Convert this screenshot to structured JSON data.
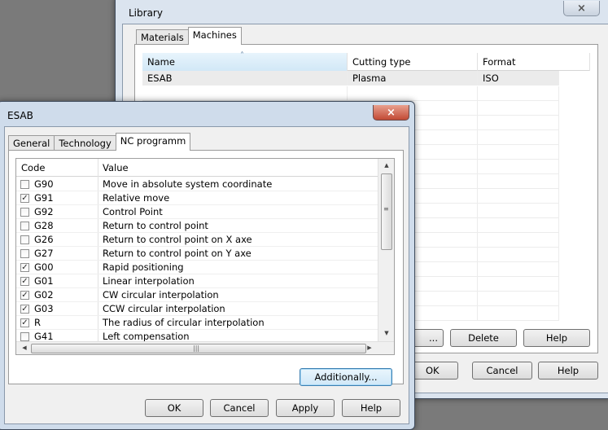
{
  "library": {
    "title": "Library",
    "close_glyph": "×",
    "tabs": [
      "Materials",
      "Machines"
    ],
    "selected_tab": 1,
    "columns": [
      "Name",
      "Cutting type",
      "Format"
    ],
    "sort_glyph": "˄",
    "rows": [
      {
        "name": "ESAB",
        "cutting_type": "Plasma",
        "format": "ISO"
      }
    ],
    "buttons": {
      "partial": "...",
      "delete": "Delete",
      "help_top": "Help",
      "ok": "OK",
      "cancel": "Cancel",
      "help": "Help"
    }
  },
  "esab": {
    "title": "ESAB",
    "close_glyph": "×",
    "tabs": [
      "General",
      "Technology",
      "NC programm"
    ],
    "selected_tab": 2,
    "columns": {
      "code": "Code",
      "value": "Value"
    },
    "rows": [
      {
        "checked": false,
        "code": "G90",
        "value": "Move in absolute system coordinate"
      },
      {
        "checked": true,
        "code": "G91",
        "value": "Relative move"
      },
      {
        "checked": false,
        "code": "G92",
        "value": "Control Point"
      },
      {
        "checked": false,
        "code": "G28",
        "value": "Return to control point"
      },
      {
        "checked": false,
        "code": "G26",
        "value": "Return to control point on X axe"
      },
      {
        "checked": false,
        "code": "G27",
        "value": "Return to control point on Y axe"
      },
      {
        "checked": true,
        "code": "G00",
        "value": "Rapid positioning"
      },
      {
        "checked": true,
        "code": "G01",
        "value": "Linear interpolation"
      },
      {
        "checked": true,
        "code": "G02",
        "value": "CW circular interpolation"
      },
      {
        "checked": true,
        "code": "G03",
        "value": "CCW circular interpolation"
      },
      {
        "checked": true,
        "code": "R",
        "value": "The radius of circular interpolation"
      },
      {
        "checked": false,
        "code": "G41",
        "value": "Left compensation"
      }
    ],
    "check_glyph": "✓",
    "scroll": {
      "up": "▲",
      "down": "▼",
      "left": "◀",
      "right": "▶",
      "grip_v": "≡",
      "grip_h": "|||"
    },
    "buttons": {
      "additionally": "Additionally...",
      "ok": "OK",
      "cancel": "Cancel",
      "apply": "Apply",
      "help": "Help"
    }
  }
}
